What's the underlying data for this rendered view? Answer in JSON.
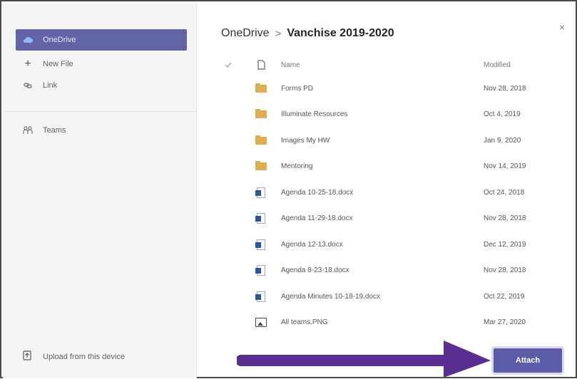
{
  "sidebar": {
    "items": [
      {
        "label": "OneDrive",
        "icon": "cloud-icon"
      },
      {
        "label": "New File",
        "icon": "plus-icon"
      },
      {
        "label": "Link",
        "icon": "link-icon"
      },
      {
        "label": "Teams",
        "icon": "teams-icon"
      }
    ],
    "upload_label": "Upload from this device"
  },
  "breadcrumb": {
    "root": "OneDrive",
    "separator": ">",
    "current": "Vanchise 2019-2020"
  },
  "close_glyph": "×",
  "table": {
    "headers": {
      "name": "Name",
      "modified": "Modified"
    },
    "rows": [
      {
        "type": "folder",
        "name": "Forms PD",
        "modified": "Nov 28, 2018"
      },
      {
        "type": "folder",
        "name": "Illuminate Resources",
        "modified": "Oct 4, 2019"
      },
      {
        "type": "folder",
        "name": "Images My HW",
        "modified": "Jan 9, 2020"
      },
      {
        "type": "folder",
        "name": "Mentoring",
        "modified": "Nov 14, 2019"
      },
      {
        "type": "word",
        "name": "Agenda 10-25-18.docx",
        "modified": "Oct 24, 2018"
      },
      {
        "type": "word",
        "name": "Agenda 11-29-18.docx",
        "modified": "Nov 28, 2018"
      },
      {
        "type": "word",
        "name": "Agenda 12-13.docx",
        "modified": "Dec 12, 2019"
      },
      {
        "type": "word",
        "name": "Agenda 8-23-18.docx",
        "modified": "Nov 28, 2018"
      },
      {
        "type": "word",
        "name": "Agenda Minutes 10-18-19.docx",
        "modified": "Oct 22, 2019"
      },
      {
        "type": "image",
        "name": "All teams.PNG",
        "modified": "Mar 27, 2020"
      }
    ]
  },
  "attach_label": "Attach",
  "colors": {
    "accent": "#6264a7",
    "arrow": "#5a2d91",
    "folder": "#dcae4f",
    "word": "#2b579a"
  }
}
